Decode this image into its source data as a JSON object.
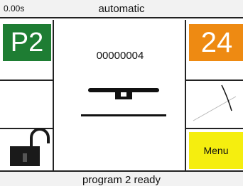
{
  "header": {
    "timer": "0.00s",
    "mode": "automatic"
  },
  "left_panel": {
    "program_label": "P2",
    "program_color": "#1e7d33",
    "lock_icon": "unlocked-padlock-icon"
  },
  "center": {
    "counter_value": "00000004",
    "tool_icon": "tool-diagram-icon"
  },
  "right_panel": {
    "count_label": "24",
    "count_color": "#ee8a12",
    "curve_icon": "curve-graph-icon",
    "menu_label": "Menu",
    "menu_color": "#f5ee0f"
  },
  "footer": {
    "status": "program 2 ready"
  }
}
